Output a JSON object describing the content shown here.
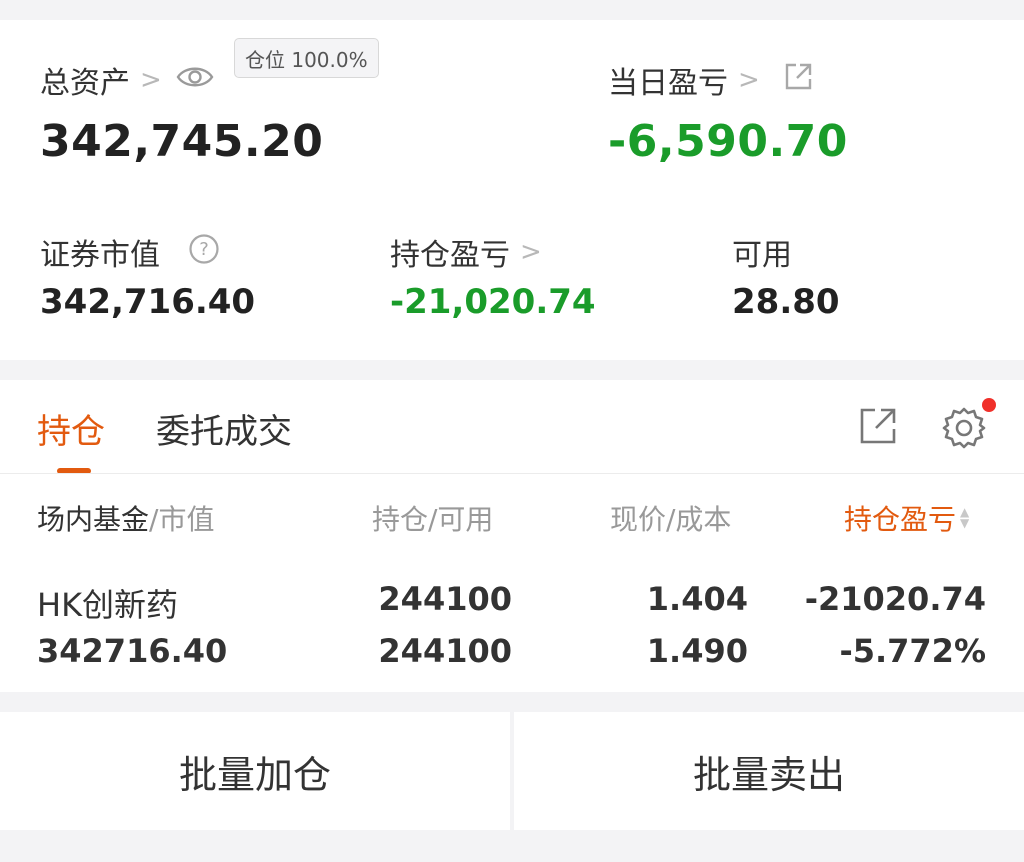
{
  "summary": {
    "total_assets_label": "总资产",
    "position_badge": "仓位 100.0%",
    "total_assets_value": "342,745.20",
    "daily_pnl_label": "当日盈亏",
    "daily_pnl_value": "-6,590.70",
    "securities_value_label": "证券市值",
    "securities_value": "342,716.40",
    "holding_pnl_label": "持仓盈亏",
    "holding_pnl_value": "-21,020.74",
    "available_label": "可用",
    "available_value": "28.80"
  },
  "tabs": {
    "holdings": "持仓",
    "orders": "委托成交"
  },
  "table": {
    "col1_main": "场内基金",
    "col1_sub": "/市值",
    "col2": "持仓/可用",
    "col3": "现价/成本",
    "col4": "持仓盈亏",
    "rows": [
      {
        "name": "HK创新药",
        "market_value": "342716.40",
        "holding": "244100",
        "available": "244100",
        "price": "1.404",
        "cost": "1.490",
        "pnl": "-21020.74",
        "pnl_pct": "-5.772%"
      }
    ]
  },
  "actions": {
    "batch_add": "批量加仓",
    "batch_sell": "批量卖出"
  },
  "colors": {
    "accent": "#e25a0f",
    "loss_green": "#1a9c2a",
    "notification_dot": "#f0302a"
  }
}
